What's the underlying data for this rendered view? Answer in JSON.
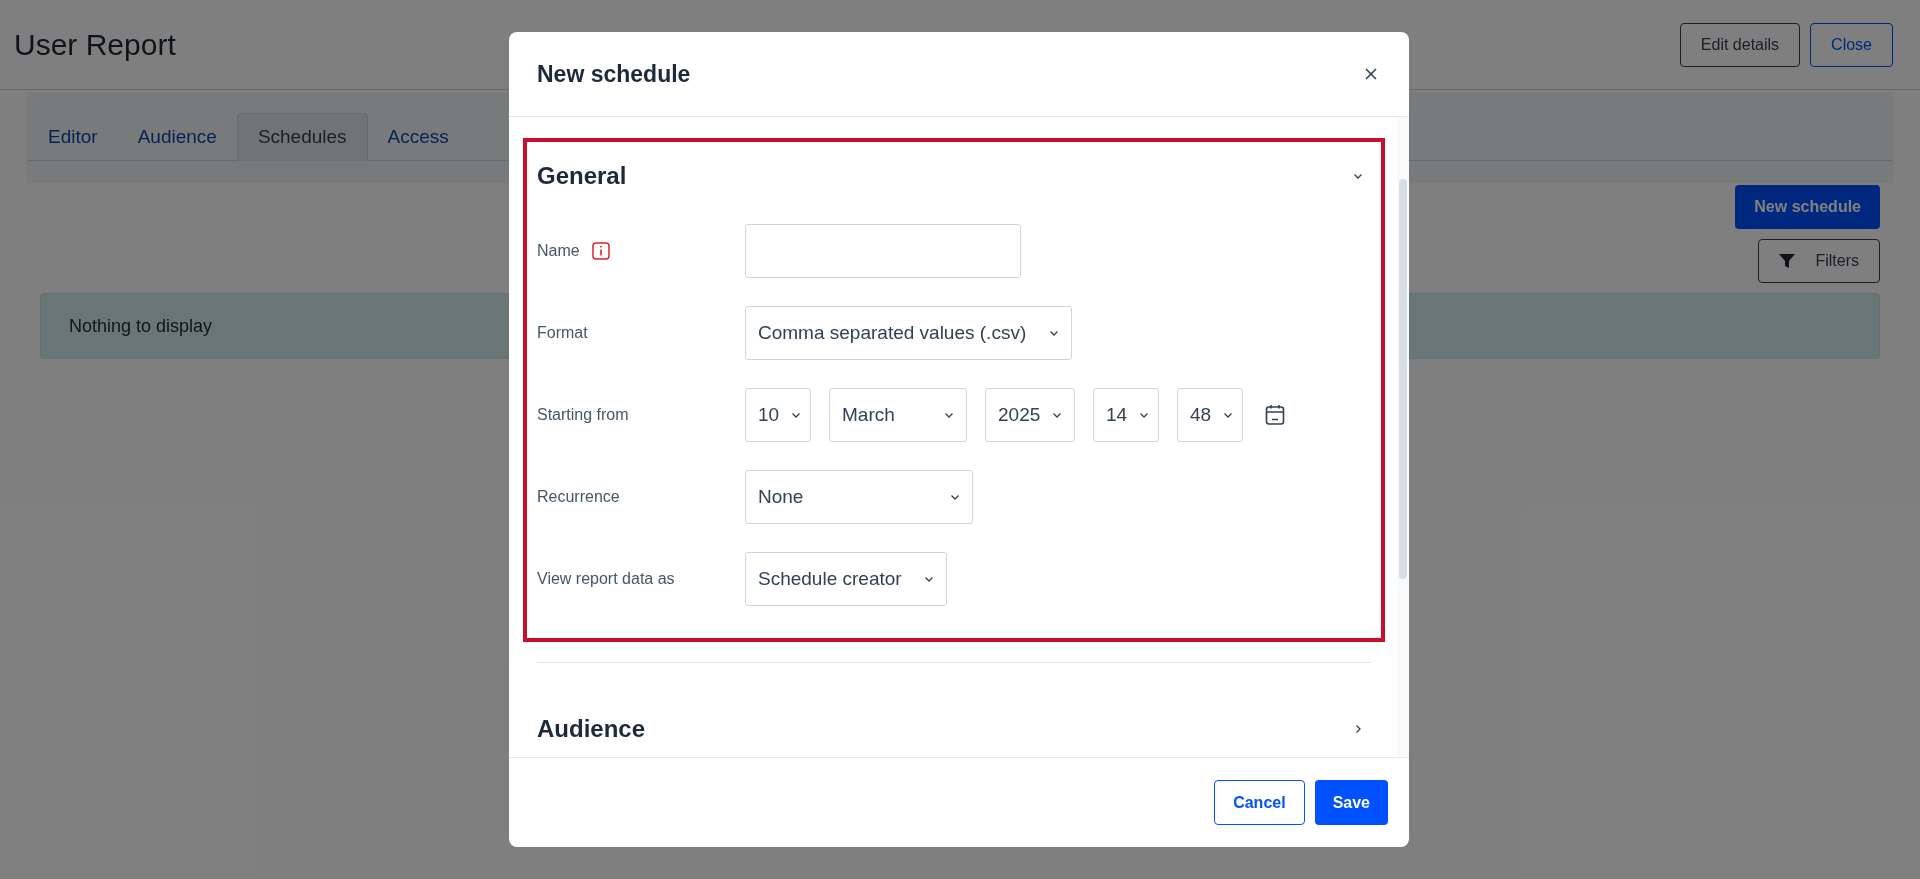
{
  "page": {
    "title": "User Report",
    "header_buttons": [
      {
        "label": "Edit details",
        "kind": "secondary"
      },
      {
        "label": "Close",
        "kind": "outline"
      }
    ],
    "tabs": [
      {
        "label": "Editor",
        "selected": false
      },
      {
        "label": "Audience",
        "selected": false
      },
      {
        "label": "Schedules",
        "selected": true
      },
      {
        "label": "Access",
        "selected": false
      }
    ],
    "new_schedule_button": "New schedule",
    "filters_button": "Filters",
    "empty_message": "Nothing to display"
  },
  "modal": {
    "title": "New schedule",
    "sections": [
      {
        "title": "General",
        "expanded": true,
        "highlighted": true,
        "fields": [
          {
            "kind": "text",
            "label": "Name",
            "info": true
          },
          {
            "kind": "select",
            "label": "Format",
            "value": "Comma separated values (.csv)"
          },
          {
            "kind": "datetime",
            "label": "Starting from",
            "parts": [
              "10",
              "March",
              "2025",
              "14",
              "48"
            ]
          },
          {
            "kind": "select",
            "label": "Recurrence",
            "value": "None"
          },
          {
            "kind": "select",
            "label": "View report data as",
            "value": "Schedule creator"
          }
        ]
      },
      {
        "title": "Audience",
        "expanded": false,
        "highlighted": false
      }
    ],
    "footer_buttons": [
      {
        "label": "Cancel",
        "kind": "outline"
      },
      {
        "label": "Save",
        "kind": "primary"
      }
    ]
  }
}
